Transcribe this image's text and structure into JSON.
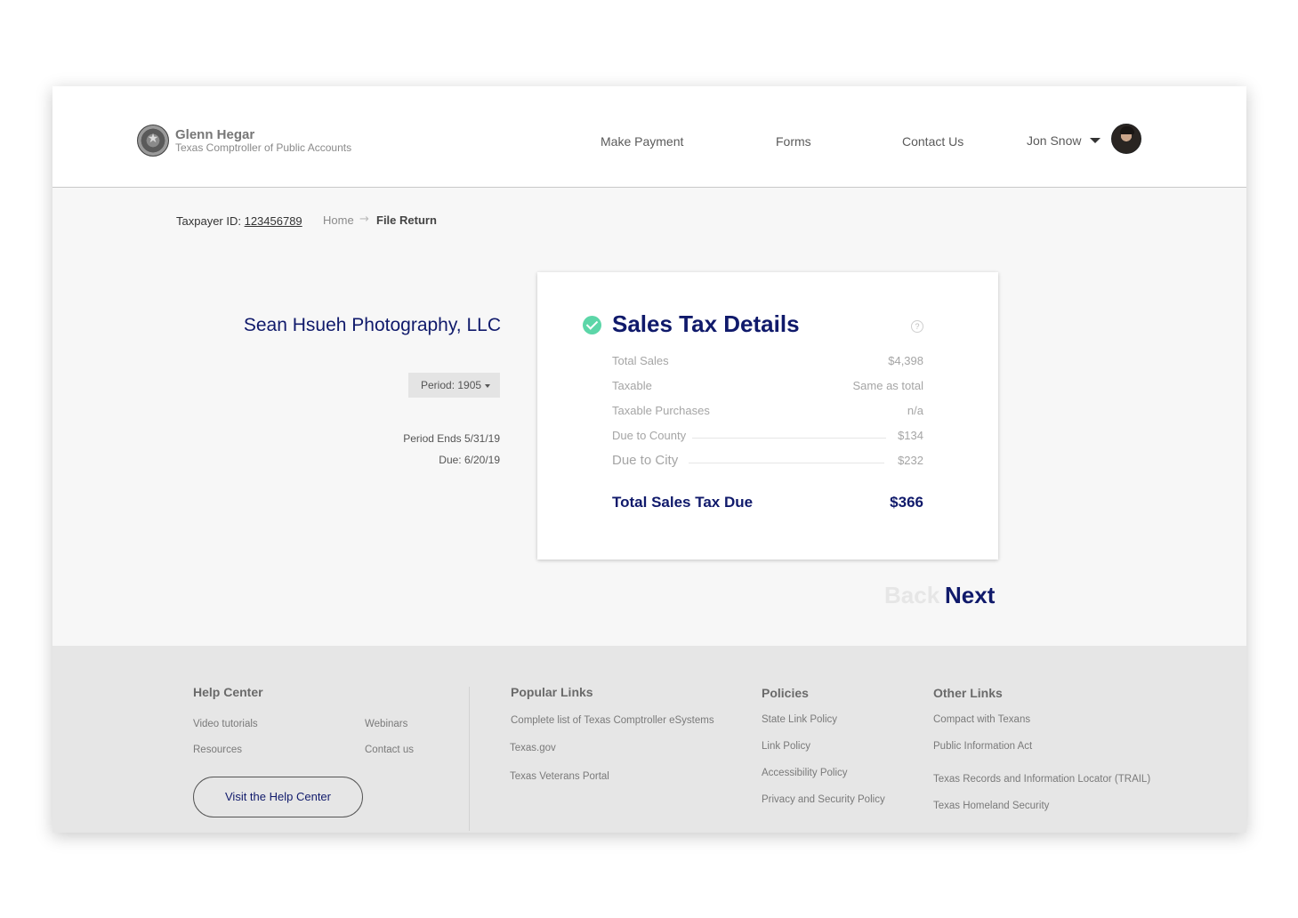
{
  "brand": {
    "name": "Glenn Hegar",
    "subtitle": "Texas Comptroller of Public Accounts"
  },
  "nav": {
    "make_payment": "Make Payment",
    "forms": "Forms",
    "contact_us": "Contact Us",
    "user_name": "Jon Snow"
  },
  "taxpayer": {
    "label": "Taxpayer ID: ",
    "id": "123456789"
  },
  "breadcrumb": {
    "home": "Home",
    "separator": "→",
    "current": "File Return"
  },
  "company": {
    "name": "Sean Hsueh Photography, LLC"
  },
  "period": {
    "selected": "Period: 1905",
    "ends": "Period Ends 5/31/19",
    "due": "Due: 6/20/19"
  },
  "card": {
    "title": "Sales Tax Details",
    "help_symbol": "?",
    "rows": [
      {
        "label": "Total Sales",
        "value": "$4,398"
      },
      {
        "label": "Taxable",
        "value": "Same as total"
      },
      {
        "label": "Taxable Purchases",
        "value": "n/a"
      },
      {
        "label": "Due to County",
        "value": "$134"
      },
      {
        "label": "Due to City",
        "value": "$232"
      }
    ],
    "total": {
      "label": "Total Sales Tax Due",
      "value": "$366"
    }
  },
  "actions": {
    "back": "Back",
    "next": "Next"
  },
  "footer": {
    "help_center": {
      "title": "Help Center",
      "links": [
        "Video tutorials",
        "Webinars",
        "Resources",
        "Contact us"
      ],
      "button": "Visit the Help Center"
    },
    "popular_links": {
      "title": "Popular Links",
      "links": [
        "Complete list of Texas Comptroller eSystems",
        "Texas.gov",
        "Texas Veterans Portal"
      ]
    },
    "policies": {
      "title": "Policies",
      "links": [
        "State Link Policy",
        "Link Policy",
        "Accessibility Policy",
        "Privacy and Security Policy"
      ]
    },
    "other_links": {
      "title": "Other Links",
      "links": [
        "Compact with Texans",
        "Public Information Act",
        "Texas Records and Information Locator (TRAIL)",
        "Texas Homeland Security"
      ]
    }
  },
  "colors": {
    "accent": "#101a6b",
    "success": "#5cd6a8",
    "footer_bg": "#e6e6e6"
  }
}
